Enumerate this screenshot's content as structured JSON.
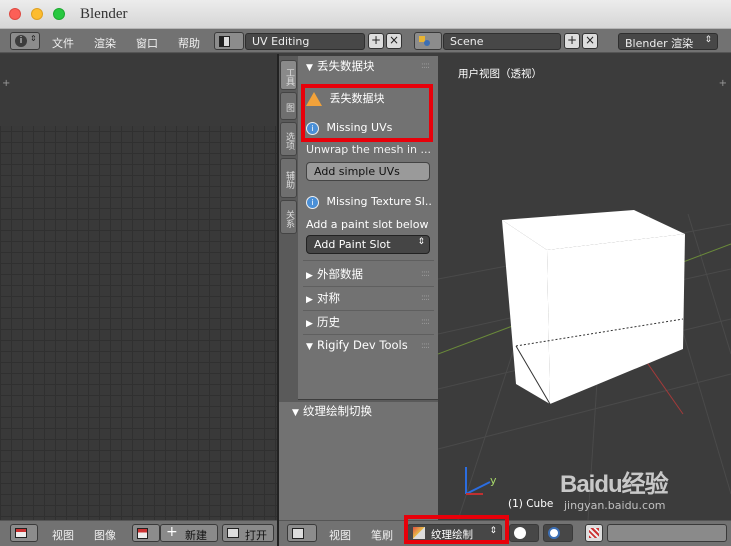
{
  "window": {
    "title": "Blender"
  },
  "menu": {
    "file": "文件",
    "render": "渲染",
    "window": "窗口",
    "help": "帮助"
  },
  "layout": {
    "screen": "UV Editing",
    "scene": "Scene",
    "engine": "Blender 渲染"
  },
  "tool_tabs": [
    "工具",
    "图",
    "选项",
    "辅助",
    "关系"
  ],
  "panel": {
    "missing_data_header": "丢失数据块",
    "missing_data_warning": "丢失数据块",
    "missing_uvs": "Missing UVs",
    "unwrap_hint": "Unwrap the mesh in ...",
    "add_simple_uvs": "Add simple UVs",
    "missing_texture_slots": "Missing Texture Sl...",
    "paint_slot_hint": "Add a paint slot below",
    "add_paint_slot": "Add Paint Slot",
    "external_data": "外部数据",
    "symmetry": "对称",
    "history": "历史",
    "rigify": "Rigify Dev Tools",
    "texture_paint_toggle": "纹理绘制切换"
  },
  "viewport": {
    "label": "用户视图（透视）",
    "object": "(1) Cube",
    "axis_y": "y"
  },
  "uv_bottombar": {
    "view": "视图",
    "image": "图像",
    "new": "新建",
    "open": "打开"
  },
  "view3d_bottombar": {
    "view": "视图",
    "brush": "笔刷",
    "mode": "纹理绘制"
  },
  "watermark": {
    "brand": "Baidu经验",
    "url": "jingyan.baidu.com"
  },
  "colors": {
    "highlight": "#e8000a",
    "warning": "#f2a23a",
    "info": "#4a8fd6"
  }
}
